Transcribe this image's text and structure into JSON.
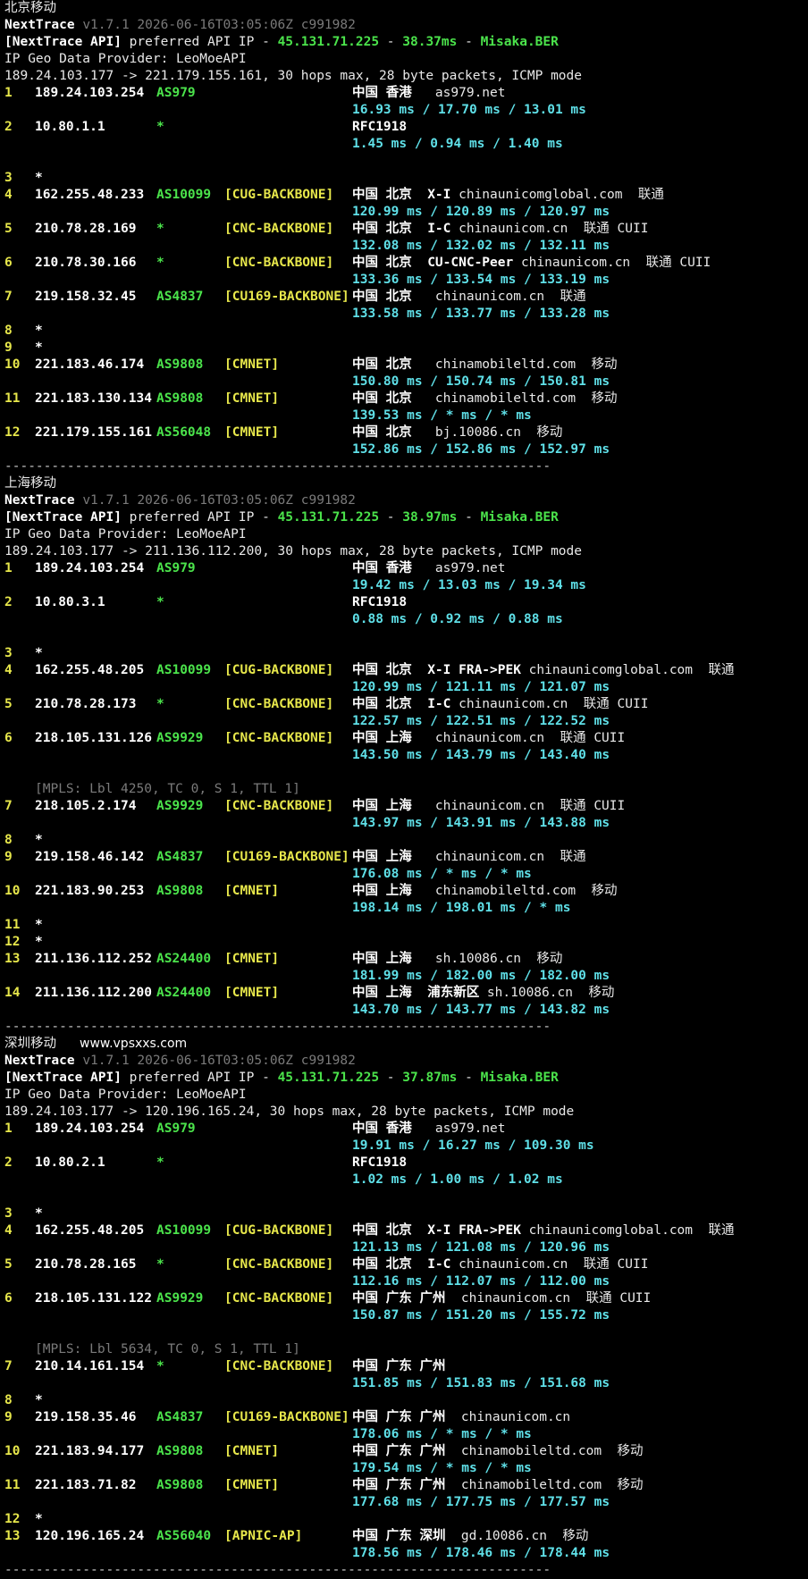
{
  "sections": [
    {
      "name": "北京移动",
      "version_line": "v1.7.1 2026-06-16T03:05:06Z c991982",
      "api_prefix": "[NextTrace API]",
      "api_mid": " preferred API IP - ",
      "api_ip": "45.131.71.225",
      "api_dash1": " - ",
      "api_ms": "38.37ms",
      "api_dash2": " - ",
      "api_node": "Misaka.BER",
      "provider_line": "IP Geo Data Provider: LeoMoeAPI",
      "route_line": "189.24.103.177 -> 221.179.155.161, 30 hops max, 28 byte packets, ICMP mode",
      "hops": [
        {
          "num": "1",
          "ip": "189.24.103.254",
          "as": "AS979",
          "net": "",
          "geo": "中国 香港",
          "host": "   as979.net",
          "rtt": "16.93 ms / 17.70 ms / 13.01 ms"
        },
        {
          "num": "2",
          "ip": "10.80.1.1",
          "as": "*",
          "net": "",
          "geo": "RFC1918",
          "host": "",
          "rtt": "1.45 ms / 0.94 ms / 1.40 ms"
        },
        {
          "num": "3",
          "ip": "*"
        },
        {
          "num": "4",
          "ip": "162.255.48.233",
          "as": "AS10099",
          "net": "[CUG-BACKBONE]",
          "geo": "中国 北京  X-I",
          "host": " chinaunicomglobal.com  联通",
          "rtt": "120.99 ms / 120.89 ms / 120.97 ms"
        },
        {
          "num": "5",
          "ip": "210.78.28.169",
          "as": "*",
          "net": "[CNC-BACKBONE]",
          "geo": "中国 北京  I-C",
          "host": " chinaunicom.cn  联通 CUII",
          "rtt": "132.08 ms / 132.02 ms / 132.11 ms"
        },
        {
          "num": "6",
          "ip": "210.78.30.166",
          "as": "*",
          "net": "[CNC-BACKBONE]",
          "geo": "中国 北京  CU-CNC-Peer",
          "host": " chinaunicom.cn  联通 CUII",
          "rtt": "133.36 ms / 133.54 ms / 133.19 ms"
        },
        {
          "num": "7",
          "ip": "219.158.32.45",
          "as": "AS4837",
          "net": "[CU169-BACKBONE]",
          "geo": "中国 北京",
          "host": "   chinaunicom.cn  联通",
          "rtt": "133.58 ms / 133.77 ms / 133.28 ms"
        },
        {
          "num": "8",
          "ip": "*"
        },
        {
          "num": "9",
          "ip": "*"
        },
        {
          "num": "10",
          "ip": "221.183.46.174",
          "as": "AS9808",
          "net": "[CMNET]",
          "geo": "中国 北京",
          "host": "   chinamobileltd.com  移动",
          "rtt": "150.80 ms / 150.74 ms / 150.81 ms"
        },
        {
          "num": "11",
          "ip": "221.183.130.134",
          "as": "AS9808",
          "net": "[CMNET]",
          "geo": "中国 北京",
          "host": "   chinamobileltd.com  移动",
          "rtt": "139.53 ms / * ms / * ms"
        },
        {
          "num": "12",
          "ip": "221.179.155.161",
          "as": "AS56048",
          "net": "[CMNET]",
          "geo": "中国 北京",
          "host": "   bj.10086.cn  移动",
          "rtt": "152.86 ms / 152.86 ms / 152.97 ms"
        }
      ]
    },
    {
      "name": "上海移动",
      "version_line": "v1.7.1 2026-06-16T03:05:06Z c991982",
      "api_prefix": "[NextTrace API]",
      "api_mid": " preferred API IP - ",
      "api_ip": "45.131.71.225",
      "api_dash1": " - ",
      "api_ms": "38.97ms",
      "api_dash2": " - ",
      "api_node": "Misaka.BER",
      "provider_line": "IP Geo Data Provider: LeoMoeAPI",
      "route_line": "189.24.103.177 -> 211.136.112.200, 30 hops max, 28 byte packets, ICMP mode",
      "hops": [
        {
          "num": "1",
          "ip": "189.24.103.254",
          "as": "AS979",
          "net": "",
          "geo": "中国 香港",
          "host": "   as979.net",
          "rtt": "19.42 ms / 13.03 ms / 19.34 ms"
        },
        {
          "num": "2",
          "ip": "10.80.3.1",
          "as": "*",
          "net": "",
          "geo": "RFC1918",
          "host": "",
          "rtt": "0.88 ms / 0.92 ms / 0.88 ms"
        },
        {
          "num": "3",
          "ip": "*"
        },
        {
          "num": "4",
          "ip": "162.255.48.205",
          "as": "AS10099",
          "net": "[CUG-BACKBONE]",
          "geo": "中国 北京  X-I FRA->PEK",
          "host": " chinaunicomglobal.com  联通",
          "rtt": "120.99 ms / 121.11 ms / 121.07 ms"
        },
        {
          "num": "5",
          "ip": "210.78.28.173",
          "as": "*",
          "net": "[CNC-BACKBONE]",
          "geo": "中国 北京  I-C",
          "host": " chinaunicom.cn  联通 CUII",
          "rtt": "122.57 ms / 122.51 ms / 122.52 ms"
        },
        {
          "num": "6",
          "ip": "218.105.131.126",
          "as": "AS9929",
          "net": "[CNC-BACKBONE]",
          "geo": "中国 上海",
          "host": "   chinaunicom.cn  联通 CUII",
          "rtt": "143.50 ms / 143.79 ms / 143.40 ms",
          "mpls": "[MPLS: Lbl 4250, TC 0, S 1, TTL 1]"
        },
        {
          "num": "7",
          "ip": "218.105.2.174",
          "as": "AS9929",
          "net": "[CNC-BACKBONE]",
          "geo": "中国 上海",
          "host": "   chinaunicom.cn  联通 CUII",
          "rtt": "143.97 ms / 143.91 ms / 143.88 ms"
        },
        {
          "num": "8",
          "ip": "*"
        },
        {
          "num": "9",
          "ip": "219.158.46.142",
          "as": "AS4837",
          "net": "[CU169-BACKBONE]",
          "geo": "中国 上海",
          "host": "   chinaunicom.cn  联通",
          "rtt": "176.08 ms / * ms / * ms"
        },
        {
          "num": "10",
          "ip": "221.183.90.253",
          "as": "AS9808",
          "net": "[CMNET]",
          "geo": "中国 上海",
          "host": "   chinamobileltd.com  移动",
          "rtt": "198.14 ms / 198.01 ms / * ms"
        },
        {
          "num": "11",
          "ip": "*"
        },
        {
          "num": "12",
          "ip": "*"
        },
        {
          "num": "13",
          "ip": "211.136.112.252",
          "as": "AS24400",
          "net": "[CMNET]",
          "geo": "中国 上海",
          "host": "   sh.10086.cn  移动",
          "rtt": "181.99 ms / 182.00 ms / 182.00 ms"
        },
        {
          "num": "14",
          "ip": "211.136.112.200",
          "as": "AS24400",
          "net": "[CMNET]",
          "geo": "中国 上海  浦东新区",
          "host": " sh.10086.cn  移动",
          "rtt": "143.70 ms / 143.77 ms / 143.82 ms"
        }
      ]
    },
    {
      "name": "深圳移动",
      "watermark": "www.vpsxxs.com",
      "version_line": "v1.7.1 2026-06-16T03:05:06Z c991982",
      "api_prefix": "[NextTrace API]",
      "api_mid": " preferred API IP - ",
      "api_ip": "45.131.71.225",
      "api_dash1": " - ",
      "api_ms": "37.87ms",
      "api_dash2": " - ",
      "api_node": "Misaka.BER",
      "provider_line": "IP Geo Data Provider: LeoMoeAPI",
      "route_line": "189.24.103.177 -> 120.196.165.24, 30 hops max, 28 byte packets, ICMP mode",
      "hops": [
        {
          "num": "1",
          "ip": "189.24.103.254",
          "as": "AS979",
          "net": "",
          "geo": "中国 香港",
          "host": "   as979.net",
          "rtt": "19.91 ms / 16.27 ms / 109.30 ms"
        },
        {
          "num": "2",
          "ip": "10.80.2.1",
          "as": "*",
          "net": "",
          "geo": "RFC1918",
          "host": "",
          "rtt": "1.02 ms / 1.00 ms / 1.02 ms"
        },
        {
          "num": "3",
          "ip": "*"
        },
        {
          "num": "4",
          "ip": "162.255.48.205",
          "as": "AS10099",
          "net": "[CUG-BACKBONE]",
          "geo": "中国 北京  X-I FRA->PEK",
          "host": " chinaunicomglobal.com  联通",
          "rtt": "121.13 ms / 121.08 ms / 120.96 ms"
        },
        {
          "num": "5",
          "ip": "210.78.28.165",
          "as": "*",
          "net": "[CNC-BACKBONE]",
          "geo": "中国 北京  I-C",
          "host": " chinaunicom.cn  联通 CUII",
          "rtt": "112.16 ms / 112.07 ms / 112.00 ms"
        },
        {
          "num": "6",
          "ip": "218.105.131.122",
          "as": "AS9929",
          "net": "[CNC-BACKBONE]",
          "geo": "中国 广东 广州",
          "host": "  chinaunicom.cn  联通 CUII",
          "rtt": "150.87 ms / 151.20 ms / 155.72 ms",
          "mpls": "[MPLS: Lbl 5634, TC 0, S 1, TTL 1]"
        },
        {
          "num": "7",
          "ip": "210.14.161.154",
          "as": "*",
          "net": "[CNC-BACKBONE]",
          "geo": "中国 广东 广州",
          "host": "",
          "rtt": "151.85 ms / 151.83 ms / 151.68 ms"
        },
        {
          "num": "8",
          "ip": "*"
        },
        {
          "num": "9",
          "ip": "219.158.35.46",
          "as": "AS4837",
          "net": "[CU169-BACKBONE]",
          "geo": "中国 广东 广州",
          "host": "  chinaunicom.cn",
          "rtt": "178.06 ms / * ms / * ms"
        },
        {
          "num": "10",
          "ip": "221.183.94.177",
          "as": "AS9808",
          "net": "[CMNET]",
          "geo": "中国 广东 广州",
          "host": "  chinamobileltd.com  移动",
          "rtt": "179.54 ms / * ms / * ms"
        },
        {
          "num": "11",
          "ip": "221.183.71.82",
          "as": "AS9808",
          "net": "[CMNET]",
          "geo": "中国 广东 广州",
          "host": "  chinamobileltd.com  移动",
          "rtt": "177.68 ms / 177.75 ms / 177.57 ms"
        },
        {
          "num": "12",
          "ip": "*"
        },
        {
          "num": "13",
          "ip": "120.196.165.24",
          "as": "AS56040",
          "net": "[APNIC-AP]",
          "geo": "中国 广东 深圳",
          "host": "  gd.10086.cn  移动",
          "rtt": "178.56 ms / 178.46 ms / 178.44 ms"
        }
      ]
    }
  ],
  "app_name": "NextTrace",
  "separator": "----------------------------------------------------------------------"
}
